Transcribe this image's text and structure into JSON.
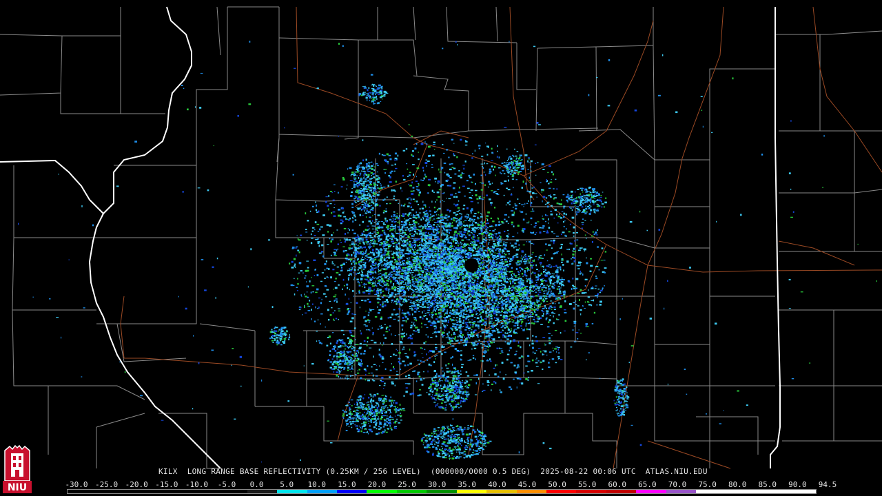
{
  "product": {
    "station": "KILX",
    "description": "LONG RANGE BASE REFLECTIVITY (0.25KM / 256 LEVEL)",
    "volume": "(000000/0000 0.5 DEG)",
    "datetime": "2025-08-22 00:06 UTC",
    "source": "ATLAS.NIU.EDU"
  },
  "color_scale": {
    "labels": [
      "-30.0",
      "-25.0",
      "-20.0",
      "-15.0",
      "-10.0",
      "-5.0",
      "0.0",
      "5.0",
      "10.0",
      "15.0",
      "20.0",
      "25.0",
      "30.0",
      "35.0",
      "40.0",
      "45.0",
      "50.0",
      "55.0",
      "60.0",
      "65.0",
      "70.0",
      "75.0",
      "80.0",
      "85.0",
      "90.0",
      "94.5"
    ],
    "colors": [
      "#000000",
      "#000000",
      "#000000",
      "#000000",
      "#000000",
      "#000000",
      "#1a1a1a",
      "#00e4ec",
      "#01a0f6",
      "#0000f6",
      "#00ff00",
      "#00c800",
      "#009000",
      "#ffff00",
      "#e7c000",
      "#ff9000",
      "#ff0000",
      "#d60000",
      "#c00000",
      "#ff00ff",
      "#9955c9",
      "#ffffff",
      "#ffffff",
      "#ffffff",
      "#ffffff"
    ]
  },
  "logo": {
    "text": "NIU",
    "colors": {
      "red": "#c8102e",
      "white": "#ffffff"
    }
  },
  "map_colors": {
    "background": "#000000",
    "county_lines": "#9a9a9a",
    "state_lines": "#ffffff",
    "highways": "#a0522d",
    "echo_light": "#3cc8f0",
    "echo_mid": "#1e8ce6",
    "echo_dark": "#1446dc",
    "echo_green": "#28c83c"
  },
  "legend_text": "KILX LONG RANGE BASE REFLECTIVITY (0.25KM / 256 LEVEL) (000000/0000 0.5 DEG) 2025-08-22 00:06 UTC ATLAS.NIU.EDU"
}
